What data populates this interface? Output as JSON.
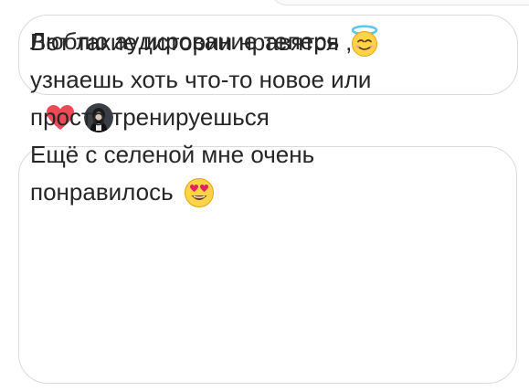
{
  "messages": [
    {
      "text": "Люблю аудирование теперь",
      "emoji": "smiling-face-with-halo"
    },
    {
      "lines": [
        "Вот такие истории нравятся ,",
        "узнаешь хоть что-то новое или",
        "просто тренируешься",
        "Ещё с селеной мне очень",
        "понравилось"
      ],
      "emoji": "smiling-face-with-heart-eyes"
    }
  ],
  "reactions": {
    "icon": "heart-icon",
    "color": "#ed4956"
  }
}
